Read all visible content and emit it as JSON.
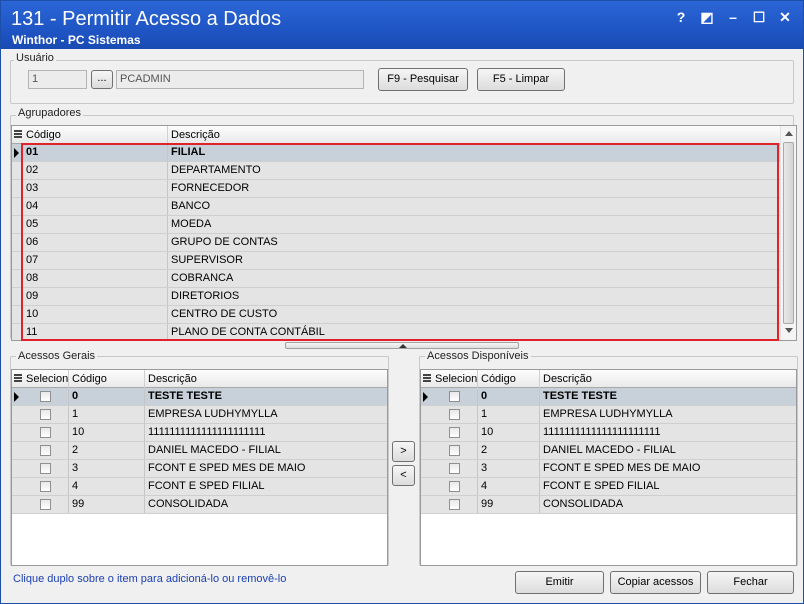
{
  "window": {
    "title": "131 - Permitir Acesso a Dados",
    "subtitle": "Winthor - PC Sistemas",
    "help_glyph": "?",
    "restore_glyph": "◩",
    "minimize_glyph": "–",
    "maximize_glyph": "☐",
    "close_glyph": "✕"
  },
  "usuario": {
    "group_label": "Usuário",
    "code_value": "1",
    "lookup_label": "...",
    "name_value": "PCADMIN",
    "search_button": "F9 - Pesquisar",
    "clear_button": "F5 - Limpar"
  },
  "agrupadores": {
    "group_label": "Agrupadores",
    "columns": [
      "Código",
      "Descrição"
    ],
    "rows": [
      {
        "codigo": "01",
        "descricao": "FILIAL"
      },
      {
        "codigo": "02",
        "descricao": "DEPARTAMENTO"
      },
      {
        "codigo": "03",
        "descricao": "FORNECEDOR"
      },
      {
        "codigo": "04",
        "descricao": "BANCO"
      },
      {
        "codigo": "05",
        "descricao": "MOEDA"
      },
      {
        "codigo": "06",
        "descricao": "GRUPO DE CONTAS"
      },
      {
        "codigo": "07",
        "descricao": "SUPERVISOR"
      },
      {
        "codigo": "08",
        "descricao": "COBRANCA"
      },
      {
        "codigo": "09",
        "descricao": "DIRETORIOS"
      },
      {
        "codigo": "10",
        "descricao": "CENTRO DE CUSTO"
      },
      {
        "codigo": "11",
        "descricao": "PLANO DE CONTA CONTÁBIL"
      }
    ]
  },
  "acessos_gerais": {
    "group_label": "Acessos Gerais",
    "columns": [
      "Selecionar",
      "Código",
      "Descrição"
    ],
    "rows": [
      {
        "codigo": "0",
        "descricao": "TESTE TESTE"
      },
      {
        "codigo": "1",
        "descricao": "EMPRESA LUDHYMYLLA"
      },
      {
        "codigo": "10",
        "descricao": "1111111111111111111111"
      },
      {
        "codigo": "2",
        "descricao": "DANIEL MACEDO - FILIAL"
      },
      {
        "codigo": "3",
        "descricao": "FCONT E SPED MES DE MAIO"
      },
      {
        "codigo": "4",
        "descricao": "FCONT E SPED FILIAL"
      },
      {
        "codigo": "99",
        "descricao": "CONSOLIDADA"
      }
    ]
  },
  "acessos_disponiveis": {
    "group_label": "Acessos Disponíveis",
    "columns": [
      "Selecionar",
      "Código",
      "Descrição"
    ],
    "rows": [
      {
        "codigo": "0",
        "descricao": "TESTE TESTE"
      },
      {
        "codigo": "1",
        "descricao": "EMPRESA LUDHYMYLLA"
      },
      {
        "codigo": "10",
        "descricao": "1111111111111111111111"
      },
      {
        "codigo": "2",
        "descricao": "DANIEL MACEDO - FILIAL"
      },
      {
        "codigo": "3",
        "descricao": "FCONT E SPED MES DE MAIO"
      },
      {
        "codigo": "4",
        "descricao": "FCONT E SPED FILIAL"
      },
      {
        "codigo": "99",
        "descricao": "CONSOLIDADA"
      }
    ]
  },
  "transfer": {
    "add_label": ">",
    "remove_label": "<"
  },
  "footer": {
    "hint": "Clique duplo sobre o item para adicioná-lo ou removê-lo",
    "emitir": "Emitir",
    "copiar": "Copiar acessos",
    "fechar": "Fechar"
  }
}
